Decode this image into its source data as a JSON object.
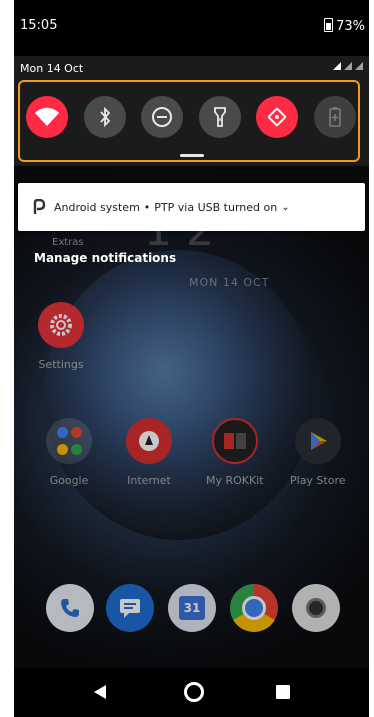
{
  "status_bar": {
    "time": "15:05",
    "battery": "73%"
  },
  "quick_settings": {
    "date": "Mon 14 Oct",
    "tiles": [
      {
        "name": "wifi",
        "state": "on"
      },
      {
        "name": "bluetooth",
        "state": "off"
      },
      {
        "name": "do-not-disturb",
        "state": "off"
      },
      {
        "name": "flashlight",
        "state": "off"
      },
      {
        "name": "auto-rotate",
        "state": "on"
      },
      {
        "name": "battery-saver",
        "state": "disabled"
      }
    ],
    "accent_color": "#ff2b45",
    "highlight_color": "#f39a16"
  },
  "notification": {
    "app": "Android system",
    "separator": "•",
    "text": "PTP via USB turned on",
    "expand": "⌄"
  },
  "home": {
    "extras_label": "Extras",
    "manage_notifications": "Manage notifications",
    "clock_digits": "1 2",
    "date": "MON 14 OCT",
    "apps": [
      {
        "label": "Settings"
      },
      {
        "label": "Google"
      },
      {
        "label": "Internet"
      },
      {
        "label": "My ROKKit"
      },
      {
        "label": "Play Store"
      }
    ],
    "dock": [
      {
        "name": "phone"
      },
      {
        "name": "messages"
      },
      {
        "name": "calendar",
        "day": "31"
      },
      {
        "name": "chrome"
      },
      {
        "name": "camera"
      }
    ]
  }
}
